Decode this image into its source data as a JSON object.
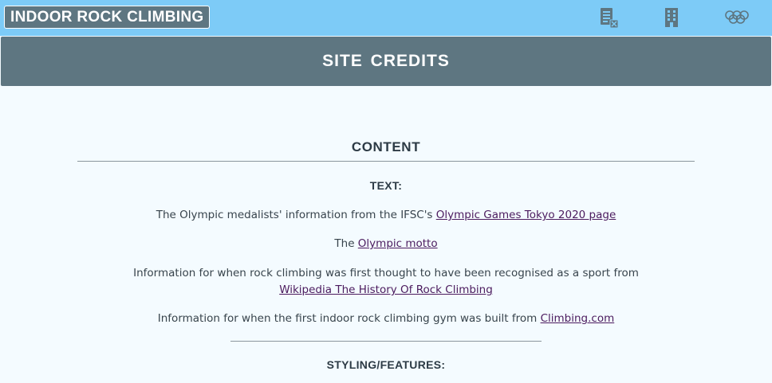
{
  "header": {
    "brand": "INDOOR ROCK CLIMBING",
    "nav": [
      {
        "icon": "calendar-list-icon"
      },
      {
        "icon": "building-icon"
      },
      {
        "icon": "olympic-rings-icon"
      }
    ]
  },
  "page": {
    "title": "SITE CREDITS"
  },
  "content": {
    "heading": "CONTENT",
    "text_heading": "TEXT:",
    "credits": [
      {
        "before": "The Olympic medalists' information from the IFSC's ",
        "link": "Olympic Games Tokyo 2020 page"
      },
      {
        "before": "The ",
        "link": "Olympic motto"
      },
      {
        "before": "Information for when rock climbing was first thought to have been recognised as a sport from ",
        "link": "Wikipedia The History Of Rock Climbing"
      },
      {
        "before": "Information for when the first indoor rock climbing gym was built from ",
        "link": "Climbing.com"
      }
    ],
    "styling_heading": "STYLING/FEATURES:"
  },
  "colors": {
    "topbar": "#7dcbf7",
    "slate": "#5e7681",
    "link": "#4b1b5e",
    "page_bg": "#f4fbff"
  }
}
